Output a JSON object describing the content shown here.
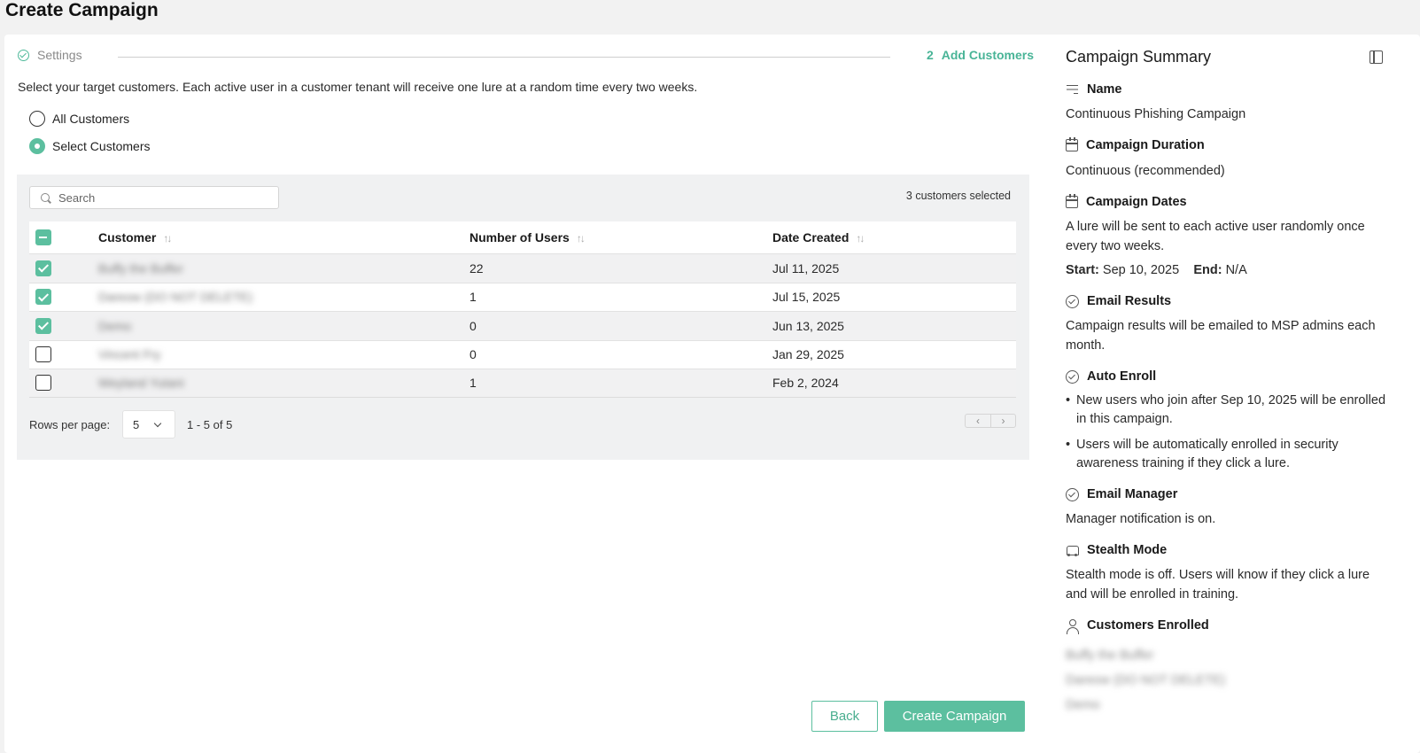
{
  "page_title": "Create Campaign",
  "stepper": {
    "step1_label": "Settings",
    "step2_number": "2",
    "step2_label": "Add Customers"
  },
  "intro_text": "Select your target customers. Each active user in a customer tenant will receive one lure at a random time every two weeks.",
  "radio": {
    "all_label": "All Customers",
    "select_label": "Select Customers",
    "selected": "select"
  },
  "search": {
    "placeholder": "Search"
  },
  "selected_count_text": "3 customers selected",
  "table": {
    "columns": [
      "Customer",
      "Number of Users",
      "Date Created"
    ],
    "rows": [
      {
        "customer": "Buffy the Buffer",
        "users": "22",
        "date": "Jul 11, 2025",
        "checked": true
      },
      {
        "customer": "Dareow (DO NOT DELETE)",
        "users": "1",
        "date": "Jul 15, 2025",
        "checked": true
      },
      {
        "customer": "Demo",
        "users": "0",
        "date": "Jun 13, 2025",
        "checked": true
      },
      {
        "customer": "Vincent Fry",
        "users": "0",
        "date": "Jan 29, 2025",
        "checked": false
      },
      {
        "customer": "Weyland Yutani",
        "users": "1",
        "date": "Feb 2, 2024",
        "checked": false
      }
    ]
  },
  "pagination": {
    "rows_per_page_label": "Rows per page:",
    "rows_per_page_value": "5",
    "range_text": "1 - 5 of 5",
    "prev_glyph": "‹",
    "next_glyph": "›"
  },
  "buttons": {
    "back": "Back",
    "create": "Create Campaign"
  },
  "summary": {
    "title": "Campaign Summary",
    "name_heading": "Name",
    "name_value": "Continuous Phishing Campaign",
    "duration_heading": "Campaign Duration",
    "duration_value": "Continuous (recommended)",
    "dates_heading": "Campaign Dates",
    "dates_text": "A lure will be sent to each active user randomly once every two weeks.",
    "start_label": "Start:",
    "start_value": "Sep 10, 2025",
    "end_label": "End:",
    "end_value": "N/A",
    "email_results_heading": "Email Results",
    "email_results_text": "Campaign results will be emailed to MSP admins each month.",
    "auto_enroll_heading": "Auto Enroll",
    "auto_enroll_bullet1": "New users who join after Sep 10, 2025 will be enrolled in this campaign.",
    "auto_enroll_bullet2": "Users will be automatically enrolled in security awareness training if they click a lure.",
    "email_manager_heading": "Email Manager",
    "email_manager_text": "Manager notification is on.",
    "stealth_heading": "Stealth Mode",
    "stealth_text": "Stealth mode is off. Users will know if they click a lure and will be enrolled in training.",
    "customers_enrolled_heading": "Customers Enrolled",
    "customers_enrolled": [
      "Buffy the Buffer",
      "Dareow (DO NOT DELETE)",
      "Demo"
    ]
  },
  "colors": {
    "accent": "#5cbf9f",
    "accent_text": "#49b497"
  },
  "icons": {
    "step1": "check-circle-icon",
    "search": "search-icon",
    "sort": "sort-icon",
    "panel_toggle": "panel-toggle-icon",
    "name": "text-lines-icon",
    "calendar": "calendar-icon",
    "check": "check-circle-icon",
    "stealth": "car-icon",
    "user": "user-icon"
  }
}
